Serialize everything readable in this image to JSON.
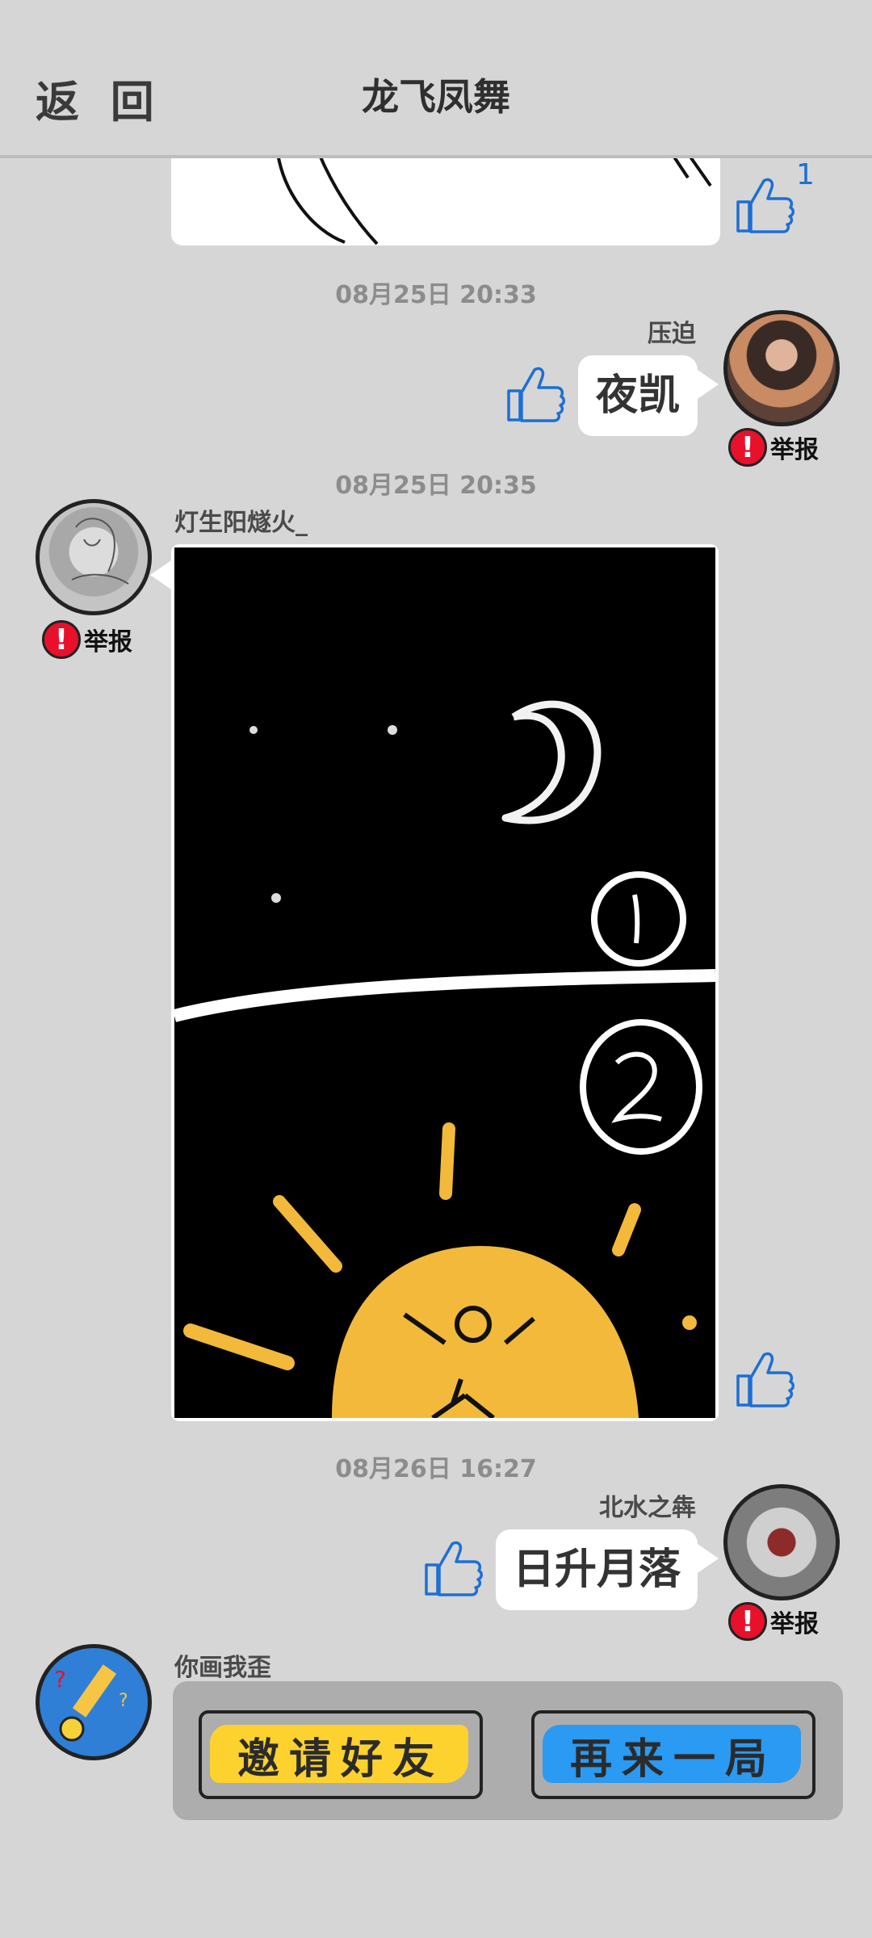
{
  "header": {
    "back_label": "返 回",
    "title": "龙飞凤舞"
  },
  "messages": [
    {
      "type": "image",
      "likes": "1"
    },
    {
      "timestamp": "08月25日  20:33",
      "sender": "压迫",
      "text": "夜凯",
      "report_label": "举报"
    },
    {
      "timestamp": "08月25日  20:35",
      "sender": "灯生阳燧火_",
      "type": "drawing",
      "report_label": "举报"
    },
    {
      "timestamp": "08月26日  16:27",
      "sender": "北水之犇",
      "text": "日升月落",
      "report_label": "举报"
    },
    {
      "sender": "你画我歪"
    }
  ],
  "game": {
    "invite_label": "邀请好友",
    "again_label": "再来一局"
  },
  "colors": {
    "background": "#d6d6d6",
    "like_blue": "#1d6fd3",
    "report_red": "#e8102b",
    "invite_yellow": "#fdd22e",
    "again_blue": "#2a9af2",
    "sun_orange": "#f2b93b"
  },
  "icons": {
    "like": "thumbs-up-icon",
    "report": "exclamation-icon"
  }
}
